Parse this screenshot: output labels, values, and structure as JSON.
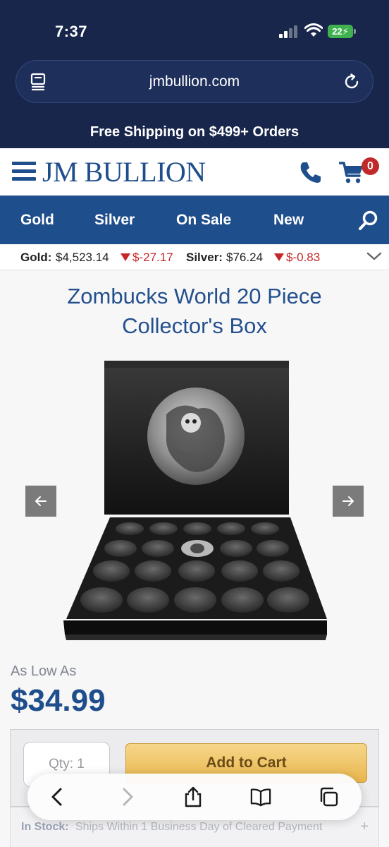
{
  "status_bar": {
    "time": "7:37",
    "battery": "22"
  },
  "browser": {
    "url": "jmbullion.com"
  },
  "promo_banner": "Free Shipping on $499+ Orders",
  "header": {
    "logo_text": "JM BULLION",
    "cart_count": "0"
  },
  "nav": {
    "items": [
      {
        "label": "Gold"
      },
      {
        "label": "Silver"
      },
      {
        "label": "On Sale"
      },
      {
        "label": "New"
      }
    ]
  },
  "ticker": {
    "gold_label": "Gold:",
    "gold_price": "$4,523.14",
    "gold_change": "$-27.17",
    "silver_label": "Silver:",
    "silver_price": "$76.24",
    "silver_change": "$-0.83"
  },
  "product": {
    "title": "Zombucks World 20 Piece Collector's Box",
    "as_low_as": "As Low As",
    "price": "$34.99",
    "qty_placeholder": "Qty: 1",
    "add_to_cart": "Add to Cart",
    "stock_label": "In Stock:",
    "stock_text": "Ships Within 1 Business Day of Cleared Payment",
    "stock_expand": "+"
  },
  "colors": {
    "navy": "#17264a",
    "brand_blue": "#1f4e8c",
    "down_red": "#c62828",
    "cart_gold": "#e9b64d"
  },
  "icons": [
    "tabs-icon",
    "reload-icon",
    "hamburger-icon",
    "phone-icon",
    "cart-icon",
    "search-icon",
    "chevron-down-icon",
    "arrow-left-icon",
    "arrow-right-icon",
    "back-icon",
    "forward-icon",
    "share-icon",
    "bookmarks-icon",
    "tabs-overview-icon"
  ]
}
